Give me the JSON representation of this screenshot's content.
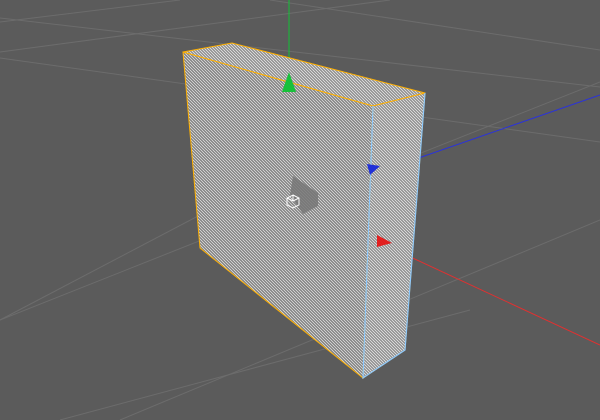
{
  "viewport": {
    "type": "3d-perspective",
    "background_color": "#5b5b5b",
    "grid_color": "#6c6c6c"
  },
  "scene": {
    "selected_object": "box",
    "selection_color": "#ffb000",
    "edge_color": "#8cc8ff",
    "hatch_color": "#c9c9c9"
  },
  "gizmo": {
    "mode": "move",
    "icon": "move-gizmo-icon",
    "axes": [
      {
        "name": "x",
        "color": "#ff0000"
      },
      {
        "name": "y",
        "color": "#00cc33"
      },
      {
        "name": "z",
        "color": "#2233ff"
      }
    ]
  }
}
